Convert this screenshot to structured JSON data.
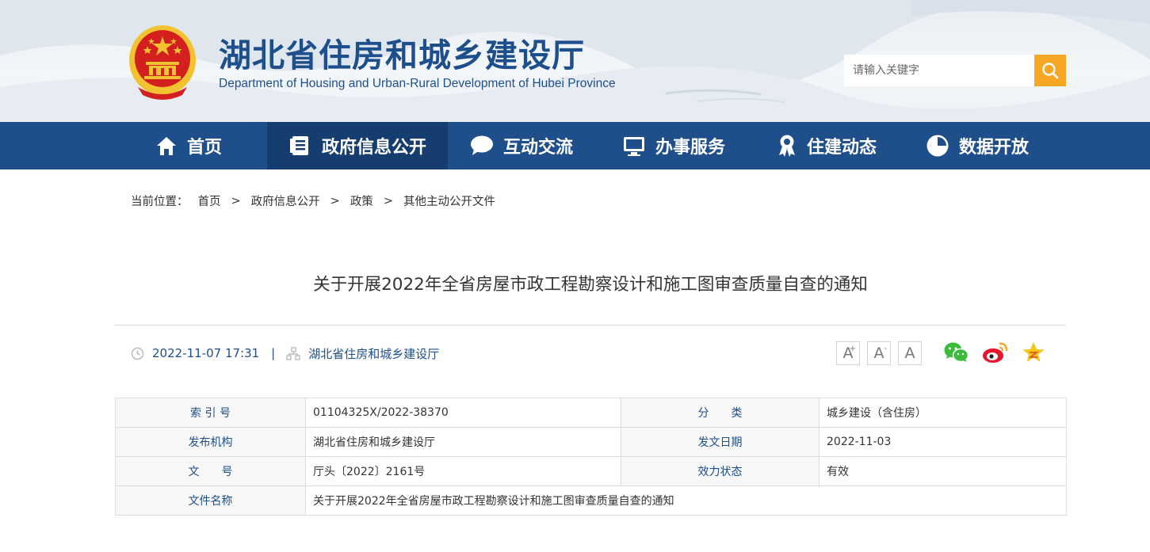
{
  "header": {
    "title": "湖北省住房和城乡建设厅",
    "subtitle": "Department of Housing and Urban-Rural Development of Hubei Province",
    "search_placeholder": "请输入关键字",
    "search_icon": "search-icon"
  },
  "nav": {
    "items": [
      {
        "label": "首页",
        "icon": "home-icon"
      },
      {
        "label": "政府信息公开",
        "icon": "document-list-icon",
        "active": true
      },
      {
        "label": "互动交流",
        "icon": "chat-bubble-icon"
      },
      {
        "label": "办事服务",
        "icon": "monitor-icon"
      },
      {
        "label": "住建动态",
        "icon": "award-ribbon-icon"
      },
      {
        "label": "数据开放",
        "icon": "pie-chart-icon"
      }
    ]
  },
  "breadcrumb": {
    "prefix": "当前位置：",
    "items": [
      "首页",
      "政府信息公开",
      "政策",
      "其他主动公开文件"
    ],
    "separator": ">"
  },
  "article": {
    "title": "关于开展2022年全省房屋市政工程勘察设计和施工图审查质量自查的通知",
    "datetime": "2022-11-07 17:31",
    "divider": "|",
    "source": "湖北省住房和城乡建设厅"
  },
  "font_buttons": [
    "A+",
    "A-",
    "A"
  ],
  "share": [
    "wechat-icon",
    "weibo-icon",
    "favorite-star-icon"
  ],
  "info_table": {
    "rows": [
      {
        "k1": "索 引 号",
        "v1": "01104325X/2022-38370",
        "k2": "分　　类",
        "v2": "城乡建设（含住房）"
      },
      {
        "k1": "发布机构",
        "v1": "湖北省住房和城乡建设厅",
        "k2": "发文日期",
        "v2": "2022-11-03"
      },
      {
        "k1": "文　　号",
        "v1": "厅头〔2022〕2161号",
        "k2": "效力状态",
        "v2": "有效"
      },
      {
        "k1": "文件名称",
        "v1": "关于开展2022年全省房屋市政工程勘察设计和施工图审查质量自查的通知"
      }
    ]
  },
  "colors": {
    "brand_blue": "#1f4f8b",
    "nav_active": "#163d6f",
    "search_button": "#f5a623",
    "emblem_red": "#d3201f",
    "emblem_gold": "#f2c230"
  }
}
